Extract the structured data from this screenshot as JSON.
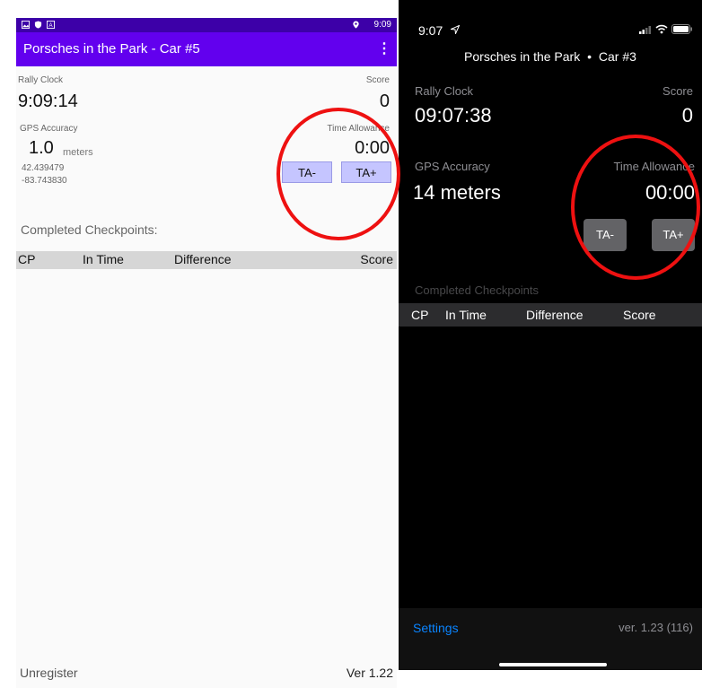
{
  "android": {
    "status_time": "9:09",
    "app_title": "Porsches in the Park - Car #5",
    "rally_clock_label": "Rally Clock",
    "rally_clock_value": "9:09:14",
    "score_label": "Score",
    "score_value": "0",
    "gps_label": "GPS Accuracy",
    "gps_value": "1.0",
    "gps_unit": "meters",
    "latitude": "42.439479",
    "longitude": "-83.743830",
    "time_allowance_label": "Time Allowance",
    "time_allowance_value": "0:00",
    "ta_minus": "TA-",
    "ta_plus": "TA+",
    "completed_label": "Completed Checkpoints:",
    "columns": [
      "CP",
      "In Time",
      "Difference",
      "Score"
    ],
    "unregister": "Unregister",
    "version": "Ver 1.22"
  },
  "ios": {
    "status_time": "9:07",
    "title": "Porsches in the Park",
    "title_sep": "•",
    "car": "Car #3",
    "rally_clock_label": "Rally Clock",
    "rally_clock_value": "09:07:38",
    "score_label": "Score",
    "score_value": "0",
    "gps_label": "GPS Accuracy",
    "gps_value": "14 meters",
    "time_allowance_label": "Time Allowance",
    "time_allowance_value": "00:00",
    "ta_minus": "TA-",
    "ta_plus": "TA+",
    "completed_label": "Completed Checkpoints",
    "columns": [
      "CP",
      "In Time",
      "Difference",
      "Score"
    ],
    "settings": "Settings",
    "version": "ver. 1.23 (116)"
  },
  "colors": {
    "android_primary": "#6200ee",
    "android_status": "#3d00a8",
    "android_button": "#c5c5ff",
    "ios_link": "#0a84ff",
    "highlight_ring": "#e11111"
  }
}
